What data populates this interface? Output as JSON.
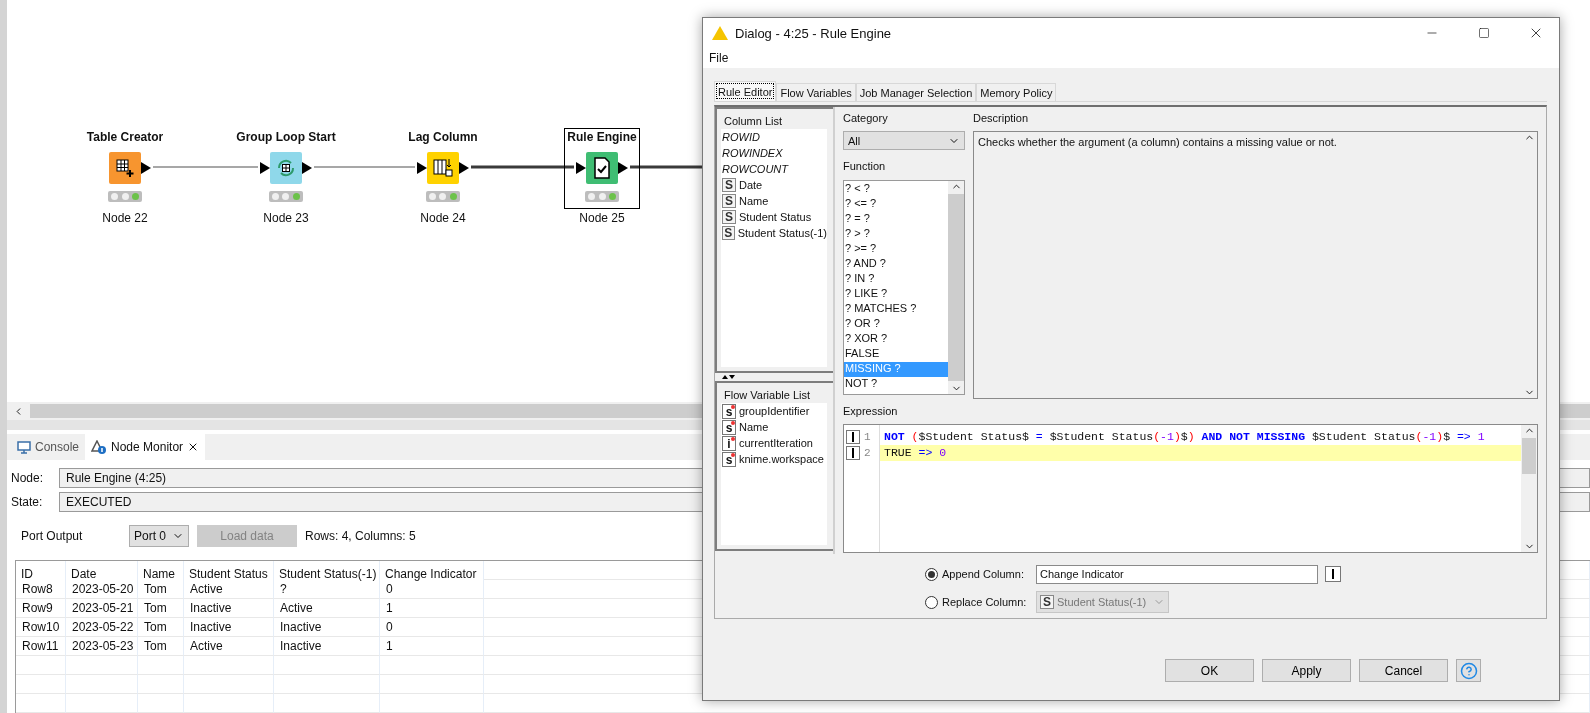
{
  "workflow": {
    "nodes": [
      {
        "title": "Table Creator",
        "label": "Node 22",
        "kind": "source",
        "color": "#f7952f",
        "selected": false
      },
      {
        "title": "Group Loop Start",
        "label": "Node 23",
        "kind": "loop",
        "color": "#8fd8ea",
        "selected": false
      },
      {
        "title": "Lag Column",
        "label": "Node 24",
        "kind": "manipulator",
        "color": "#ffd200",
        "selected": false
      },
      {
        "title": "Rule Engine",
        "label": "Node 25",
        "kind": "rule",
        "color": "#3fbd73",
        "selected": true
      }
    ],
    "edges": [
      {
        "kind": "thin"
      },
      {
        "kind": "thin"
      },
      {
        "kind": "thick"
      },
      {
        "kind": "thick"
      }
    ]
  },
  "bottom_panel": {
    "tabs": [
      {
        "label": "Console",
        "kind": "console",
        "selected": false
      },
      {
        "label": "Node Monitor",
        "kind": "monitor",
        "selected": true
      }
    ],
    "node_label": "Node:",
    "node_value": "Rule Engine  (4:25)",
    "state_label": "State:",
    "state_value": "EXECUTED",
    "port_label": "Port Output",
    "port_select": "Port 0",
    "load_button": {
      "label": "Load data",
      "disabled": true
    },
    "summary": "Rows: 4, Columns: 5",
    "table": {
      "columns": [
        "ID",
        "Date",
        "Name",
        "Student Status",
        "Student Status(-1)",
        "Change Indicator"
      ],
      "rows": [
        [
          "Row8",
          "2023-05-20",
          "Tom",
          "Active",
          "?",
          "0"
        ],
        [
          "Row9",
          "2023-05-21",
          "Tom",
          "Inactive",
          "Active",
          "1"
        ],
        [
          "Row10",
          "2023-05-22",
          "Tom",
          "Inactive",
          "Inactive",
          "0"
        ],
        [
          "Row11",
          "2023-05-23",
          "Tom",
          "Active",
          "Inactive",
          "1"
        ]
      ]
    }
  },
  "dialog": {
    "title": "Dialog - 4:25 - Rule Engine",
    "menu": [
      "File"
    ],
    "tabs": [
      {
        "label": "Rule Editor",
        "selected": true
      },
      {
        "label": "Flow Variables",
        "selected": false
      },
      {
        "label": "Job Manager Selection",
        "selected": false
      },
      {
        "label": "Memory Policy",
        "selected": false
      }
    ],
    "column_list": {
      "title": "Column List",
      "items": [
        {
          "name": "ROWID",
          "kind": "special"
        },
        {
          "name": "ROWINDEX",
          "kind": "special"
        },
        {
          "name": "ROWCOUNT",
          "kind": "special"
        },
        {
          "name": "Date",
          "kind": "column",
          "type_icon": "S"
        },
        {
          "name": "Name",
          "kind": "column",
          "type_icon": "S"
        },
        {
          "name": "Student Status",
          "kind": "column",
          "type_icon": "S"
        },
        {
          "name": "Student Status(-1)",
          "kind": "column",
          "type_icon": "S"
        }
      ]
    },
    "flow_variable_list": {
      "title": "Flow Variable List",
      "items": [
        {
          "name": "groupIdentifier",
          "type_icon": "s"
        },
        {
          "name": "Name",
          "type_icon": "s"
        },
        {
          "name": "currentIteration",
          "type_icon": "i"
        },
        {
          "name": "knime.workspace",
          "type_icon": "s"
        }
      ]
    },
    "category": {
      "label": "Category",
      "value": "All"
    },
    "function": {
      "label": "Function",
      "items": [
        {
          "text": "? < ?",
          "selected": false
        },
        {
          "text": "? <= ?",
          "selected": false
        },
        {
          "text": "? = ?",
          "selected": false
        },
        {
          "text": "? > ?",
          "selected": false
        },
        {
          "text": "? >= ?",
          "selected": false
        },
        {
          "text": "? AND ?",
          "selected": false
        },
        {
          "text": "? IN ?",
          "selected": false
        },
        {
          "text": "? LIKE ?",
          "selected": false
        },
        {
          "text": "? MATCHES ?",
          "selected": false
        },
        {
          "text": "? OR ?",
          "selected": false
        },
        {
          "text": "? XOR ?",
          "selected": false
        },
        {
          "text": "FALSE",
          "selected": false
        },
        {
          "text": "MISSING ?",
          "selected": true
        },
        {
          "text": "NOT ?",
          "selected": false
        }
      ]
    },
    "description": {
      "label": "Description",
      "text": "Checks whether the argument (a column) contains a missing value or not."
    },
    "expression": {
      "label": "Expression",
      "lines": [
        {
          "number": "1",
          "current": false,
          "tokens": [
            {
              "t": "NOT",
              "kind": "keyword"
            },
            {
              "t": " (",
              "kind": "paren"
            },
            {
              "t": "$Student Status$",
              "kind": "plain"
            },
            {
              "t": " = ",
              "kind": "operator"
            },
            {
              "t": "$Student Status",
              "kind": "plain"
            },
            {
              "t": "(",
              "kind": "paren"
            },
            {
              "t": "-1",
              "kind": "number"
            },
            {
              "t": ")",
              "kind": "paren"
            },
            {
              "t": "$",
              "kind": "plain"
            },
            {
              "t": ")",
              "kind": "paren"
            },
            {
              "t": " AND NOT MISSING ",
              "kind": "keyword"
            },
            {
              "t": "$Student Status",
              "kind": "plain"
            },
            {
              "t": "(",
              "kind": "paren"
            },
            {
              "t": "-1",
              "kind": "number"
            },
            {
              "t": ")",
              "kind": "paren"
            },
            {
              "t": "$",
              "kind": "plain"
            },
            {
              "t": " => ",
              "kind": "operator"
            },
            {
              "t": "1",
              "kind": "number"
            }
          ]
        },
        {
          "number": "2",
          "current": true,
          "tokens": [
            {
              "t": "TRUE",
              "kind": "plain"
            },
            {
              "t": " => ",
              "kind": "operator"
            },
            {
              "t": "0",
              "kind": "number"
            }
          ]
        }
      ]
    },
    "append": {
      "label": "Append Column:",
      "selected": true,
      "value": "Change Indicator"
    },
    "replace": {
      "label": "Replace Column:",
      "selected": false,
      "type_icon": "S",
      "value": "Student Status(-1)",
      "disabled": true
    },
    "buttons": [
      "OK",
      "Apply",
      "Cancel"
    ]
  }
}
